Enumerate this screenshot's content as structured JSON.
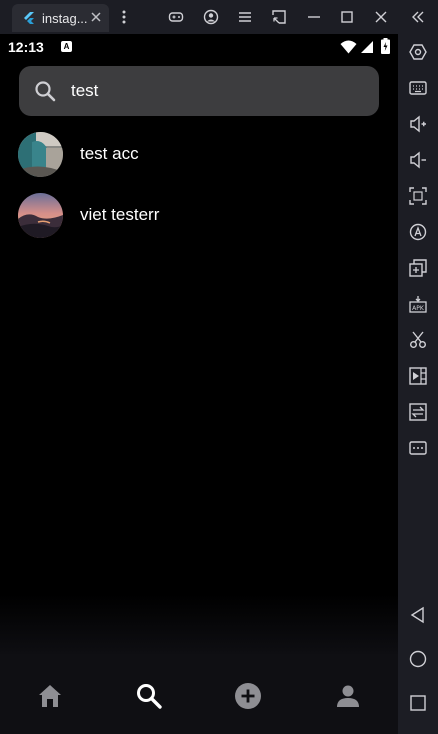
{
  "window": {
    "tab_title": "instag..."
  },
  "phone": {
    "status_time": "12:13",
    "status_badge": "A"
  },
  "search": {
    "query": "test"
  },
  "results": [
    {
      "name": "test acc"
    },
    {
      "name": "viet testerr"
    }
  ],
  "bottom_nav": {
    "items": [
      "home-icon",
      "search-icon",
      "add-post-icon",
      "profile-icon"
    ],
    "active": "search-icon"
  },
  "colors": {
    "screen_bg": "#000000",
    "search_bg": "#3d3d3f",
    "nav_active": "#ffffff",
    "nav_inactive": "#8e8e93",
    "emulator_chrome": "#1c1d24"
  }
}
